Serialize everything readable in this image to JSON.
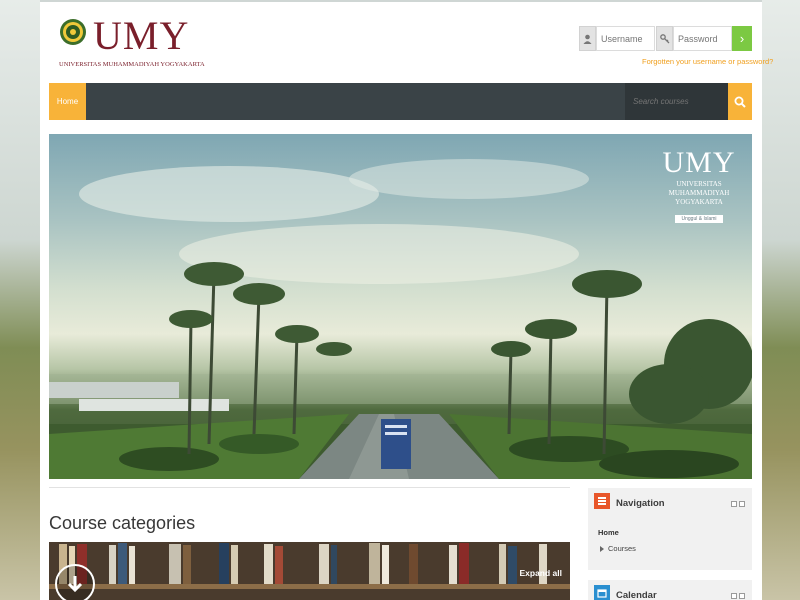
{
  "header": {
    "logo_text": "UMY",
    "logo_subtitle": "UNIVERSITAS MUHAMMADIYAH YOGYAKARTA",
    "logo_color": "#7a1f2b"
  },
  "login": {
    "username_placeholder": "Username",
    "password_placeholder": "Password",
    "go_label": "›",
    "forgot_text": "Forgotten your username or password?",
    "user_icon": "user-icon",
    "key_icon": "key-icon"
  },
  "navbar": {
    "home_label": "Home",
    "search_placeholder": "Search courses",
    "accent_color": "#f8b339",
    "bar_color": "#3a4347"
  },
  "hero": {
    "logo_main": "UMY",
    "logo_sub_line1": "UNIVERSITAS",
    "logo_sub_line2": "MUHAMMADIYAH",
    "logo_sub_line3": "YOGYAKARTA",
    "logo_badge": "Unggul & Islami"
  },
  "main": {
    "section_title": "Course categories",
    "expand_all": "Expand all"
  },
  "blocks": {
    "navigation": {
      "title": "Navigation",
      "home": "Home",
      "courses": "Courses",
      "icon_color": "#e8562a"
    },
    "calendar": {
      "title": "Calendar",
      "icon_color": "#2a8fd0"
    }
  }
}
